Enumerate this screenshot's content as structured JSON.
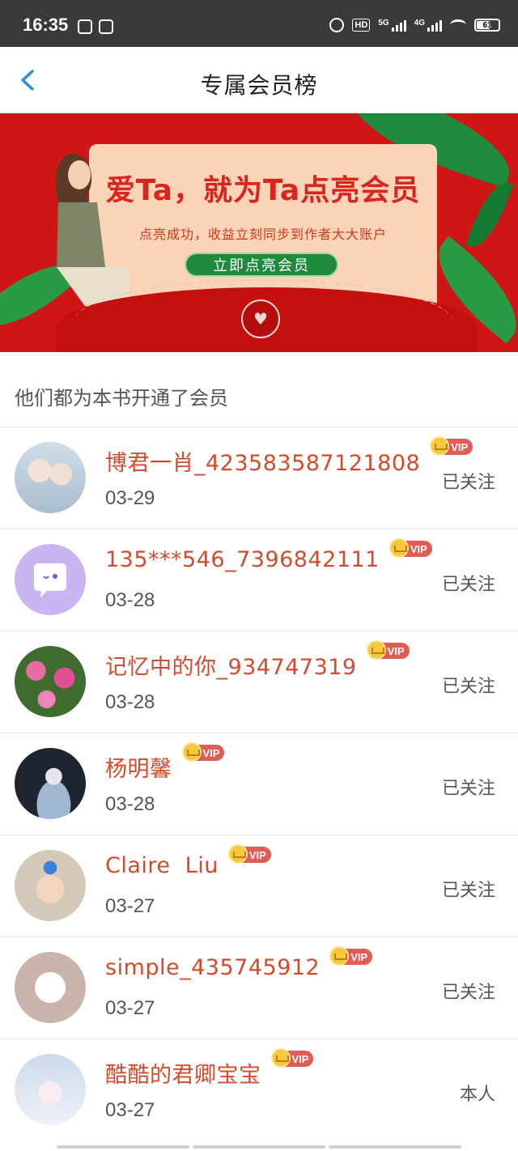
{
  "status_bar": {
    "time": "16:35",
    "right_icons": [
      "alarm-icon",
      "hd-icon",
      "signal-5g-icon",
      "signal-4g-icon",
      "wifi-icon",
      "battery-icon"
    ],
    "hd_label": "HD",
    "net_5g": "5G",
    "net_4g": "4G",
    "battery_level": "61"
  },
  "header": {
    "title": "专属会员榜",
    "back_icon": "chevron-left-icon"
  },
  "banner": {
    "title": "爱Ta，就为Ta点亮会员",
    "subtitle": "点亮成功，收益立刻同步到作者大大账户",
    "cta": "立即点亮会员",
    "colors": {
      "background": "#cf1616",
      "card": "#fbd3b6",
      "cta": "#1f8a3c"
    }
  },
  "section": {
    "title": "他们都为本书开通了会员"
  },
  "members": [
    {
      "name": "博君一肖_423583587121808",
      "badge": "VIP",
      "date": "03-29",
      "status": "已关注",
      "avatar_color": "#b9c8d6"
    },
    {
      "name": "135***546_7396842111",
      "badge": "VIP",
      "date": "03-28",
      "status": "已关注",
      "avatar_color": "#c9b5f2"
    },
    {
      "name": "记忆中的你_934747319",
      "badge": "VIP",
      "date": "03-28",
      "status": "已关注",
      "avatar_color": "#4f7d3a"
    },
    {
      "name": "杨明馨",
      "badge": "VIP",
      "date": "03-28",
      "status": "已关注",
      "avatar_color": "#2c3340"
    },
    {
      "name": "Claire  Liu",
      "badge": "VIP",
      "date": "03-27",
      "status": "已关注",
      "avatar_color": "#d7c9b9"
    },
    {
      "name": "simple_435745912",
      "badge": "VIP",
      "date": "03-27",
      "status": "已关注",
      "avatar_color": "#d8c6c0"
    },
    {
      "name": "酷酷的君卿宝宝",
      "badge": "VIP",
      "date": "03-27",
      "status": "本人",
      "avatar_color": "#dfe6f1"
    }
  ],
  "colors": {
    "accent_name": "#d24b2c",
    "vip": "#e25b57",
    "status_bar": "#3a3a3a",
    "back_chevron": "#2a8de0"
  }
}
